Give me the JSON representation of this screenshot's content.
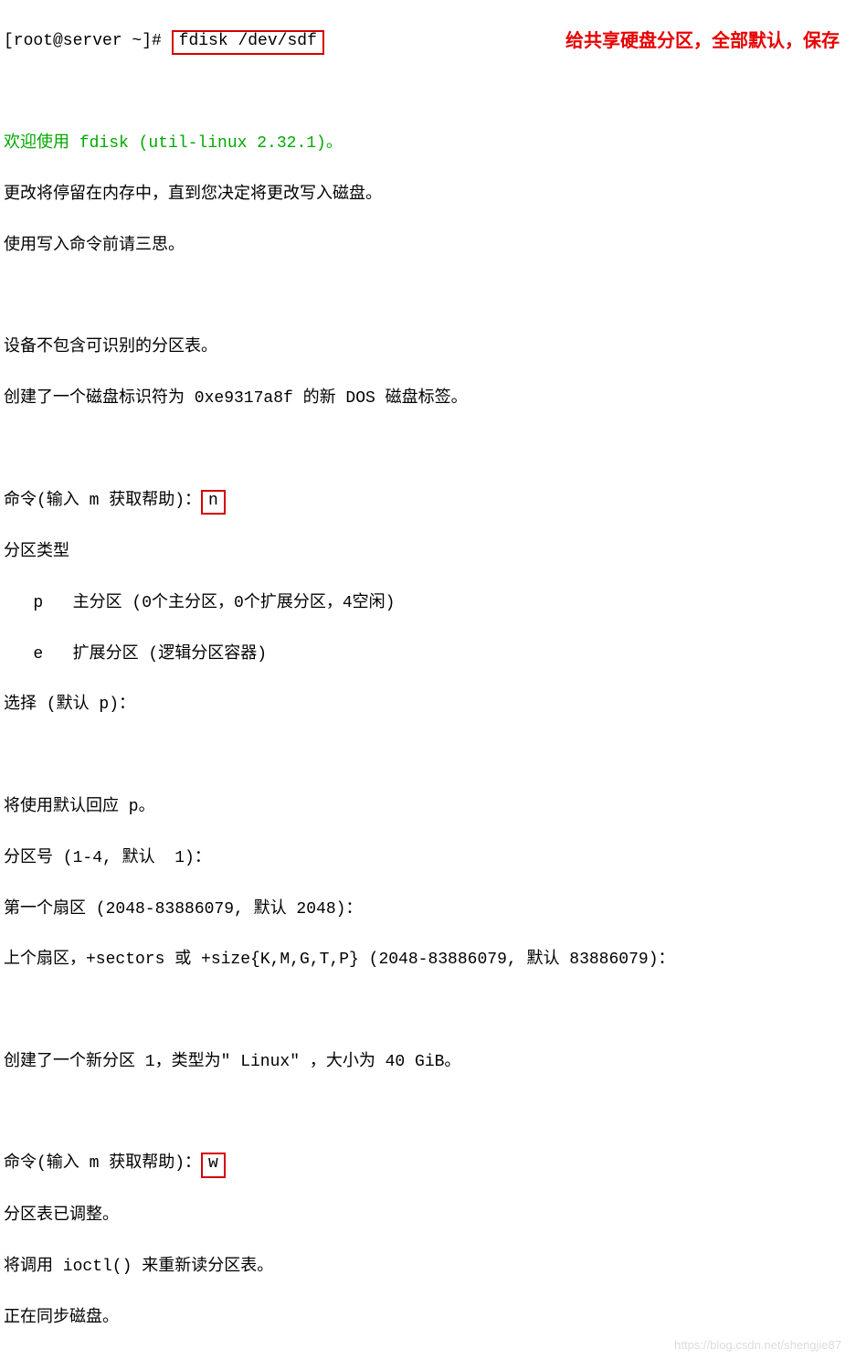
{
  "annotation": "给共享硬盘分区，全部默认，保存",
  "terminal": {
    "prompt": "[root@server ~]# ",
    "command": "fdisk /dev/sdf",
    "welcome_prefix": "欢迎使用 ",
    "welcome_cmd": "fdisk (util-linux 2.32.1)",
    "welcome_suffix": "。",
    "line_memory": "更改将停留在内存中，直到您决定将更改写入磁盘。",
    "line_careful": "使用写入命令前请三思。",
    "line_no_part_table": "设备不包含可识别的分区表。",
    "line_dos_label": "创建了一个磁盘标识符为 0xe9317a8f 的新 DOS 磁盘标签。",
    "cmd_prompt1_prefix": "命令(输入 m 获取帮助)：",
    "cmd_input1": "n",
    "part_type_label": "分区类型",
    "part_primary": "   p   主分区 (0个主分区，0个扩展分区，4空闲)",
    "part_extended": "   e   扩展分区 (逻辑分区容器)",
    "select_default": "选择 (默认 p)：",
    "using_default_p": "将使用默认回应 p。",
    "part_number": "分区号 (1-4, 默认  1)：",
    "first_sector": "第一个扇区 (2048-83886079, 默认 2048)：",
    "last_sector": "上个扇区，+sectors 或 +size{K,M,G,T,P} (2048-83886079, 默认 83886079)：",
    "created_partition": "创建了一个新分区 1，类型为\" Linux\" ，大小为 40 GiB。",
    "cmd_prompt2_prefix": "命令(输入 m 获取帮助)：",
    "cmd_input2": "w",
    "table_altered": "分区表已调整。",
    "ioctl_call": "将调用 ioctl() 来重新读分区表。",
    "syncing": "正在同步磁盘。"
  },
  "watermark": "https://blog.csdn.net/shengjie87"
}
